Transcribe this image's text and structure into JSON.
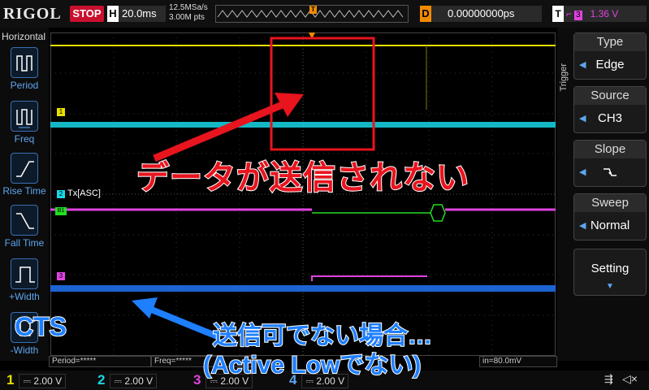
{
  "topbar": {
    "brand": "RIGOL",
    "run_state": "STOP",
    "horizontal_label": "H",
    "timebase": "20.0ms",
    "sample_rate": "12.5MSa/s",
    "memory_depth": "3.00M pts",
    "trigger_marker": "T",
    "delay_label": "D",
    "delay_value": "0.00000000ps",
    "trigger_label": "T",
    "trigger_source_badge": "3",
    "trigger_level": "1.36 V",
    "colors": {
      "stop": "#c8102e",
      "delay": "#f28a00",
      "ch3": "#e043e0"
    }
  },
  "left_menu": {
    "title": "Horizontal",
    "items": [
      {
        "label": "Period",
        "icon": "period-icon"
      },
      {
        "label": "Freq",
        "icon": "frequency-icon"
      },
      {
        "label": "Rise Time",
        "icon": "rise-time-icon"
      },
      {
        "label": "Fall Time",
        "icon": "fall-time-icon"
      },
      {
        "label": "+Width",
        "icon": "positive-width-icon"
      },
      {
        "label": "-Width",
        "icon": "negative-width-icon"
      }
    ]
  },
  "right_menu": {
    "section": "Trigger",
    "items": [
      {
        "title": "Type",
        "value": "Edge"
      },
      {
        "title": "Source",
        "value": "CH3"
      },
      {
        "title": "Slope",
        "value": "falling-edge-icon"
      },
      {
        "title": "Sweep",
        "value": "Normal"
      },
      {
        "title": "Setting",
        "value": ""
      }
    ]
  },
  "waveforms": {
    "ch1_marker": "1",
    "ch2_marker": "2",
    "decode_label": "Tx[ASC]",
    "bus_marker": "B1",
    "ch3_marker": "3",
    "trigger_level_marker": "T",
    "ch4_marker": "4",
    "colors": {
      "ch1": "#e8e000",
      "ch2": "#18d8e8",
      "ch3": "#e043e0",
      "ch4": "#1e6fe8",
      "decode": "#22dd22"
    }
  },
  "measurements": {
    "period": "Period=*****",
    "freq": "Freq=*****",
    "min": "in=80.0mV"
  },
  "channels": [
    {
      "num": "1",
      "value": "2.00 V",
      "color": "#e8e000"
    },
    {
      "num": "2",
      "value": "2.00 V",
      "color": "#18d8e8"
    },
    {
      "num": "3",
      "value": "2.00 V",
      "color": "#e043e0"
    },
    {
      "num": "4",
      "value": "2.00 V",
      "color": "#1e6fe8"
    }
  ],
  "annotations": {
    "no_data": "データが送信されない",
    "cts": "CTS",
    "not_sendable": "送信可でない場合…",
    "active_low": "(Active Lowでない)"
  }
}
